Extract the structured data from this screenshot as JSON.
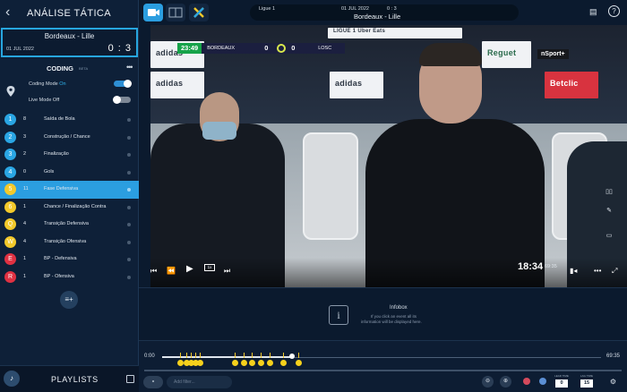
{
  "sidebar": {
    "title": "ANÁLISE TÁTICA",
    "back_icon": "chevron-left-icon",
    "match": {
      "teams": "Bordeaux - Lille",
      "date": "01 JUL 2022",
      "score": "0 : 3"
    },
    "coding": {
      "title": "CODING",
      "beta": "BETA",
      "menu_icon": "more-icon"
    },
    "toggles": [
      {
        "label": "Coding Mode",
        "value": "On",
        "state": "on"
      },
      {
        "label": "Live Mode",
        "value": "Off",
        "state": "off"
      }
    ],
    "codes": [
      {
        "key": "1",
        "count": "8",
        "label": "Saída de Bola",
        "color": "#2aa6e4",
        "active": false
      },
      {
        "key": "2",
        "count": "3",
        "label": "Construção / Chance",
        "color": "#2aa6e4",
        "active": false
      },
      {
        "key": "3",
        "count": "2",
        "label": "Finalização",
        "color": "#2aa6e4",
        "active": false
      },
      {
        "key": "4",
        "count": "0",
        "label": "Gols",
        "color": "#2aa6e4",
        "active": false
      },
      {
        "key": "5",
        "count": "11",
        "label": "Fase Defensiva",
        "color": "#f3c92a",
        "active": true
      },
      {
        "key": "6",
        "count": "1",
        "label": "Chance / Finalização Contra",
        "color": "#f3c92a",
        "active": false
      },
      {
        "key": "Q",
        "count": "4",
        "label": "Transição Defensiva",
        "color": "#f3c92a",
        "active": false
      },
      {
        "key": "W",
        "count": "4",
        "label": "Transição Ofensiva",
        "color": "#f3c92a",
        "active": false
      },
      {
        "key": "E",
        "count": "1",
        "label": "BP - Defensiva",
        "color": "#e03142",
        "active": false
      },
      {
        "key": "R",
        "count": "1",
        "label": "BP - Ofensiva",
        "color": "#e03142",
        "active": false
      }
    ],
    "add_label": "≡+",
    "playlists_label": "PLAYLISTS"
  },
  "topbar": {
    "league": "Ligue 1",
    "date": "01 JUL 2022",
    "score": "0 : 3",
    "teams": "Bordeaux - Lille"
  },
  "video": {
    "scorebug": {
      "time": "23:49",
      "home": "BORDEAUX",
      "home_score": "0",
      "away_score": "0",
      "away": "LOSC"
    },
    "boards": [
      "adidas",
      "adidas",
      "LIGUE 1 Uber Eats",
      "adidas",
      "Betclic",
      "Reguet"
    ],
    "broadcaster": "nSport+",
    "current_time": "18:34",
    "duration": "69:35",
    "speed": "1x"
  },
  "infobox": {
    "title": "Infobox",
    "line1": "If you click an event all its",
    "line2": "information will be displayed here."
  },
  "timeline": {
    "start": "0:00",
    "end": "69:35",
    "progress": 0.295,
    "events": [
      0.04,
      0.055,
      0.065,
      0.075,
      0.085,
      0.165,
      0.185,
      0.205,
      0.225,
      0.245,
      0.275,
      0.31
    ],
    "filter_placeholder": "Add filter...",
    "lead_time_label": "LEAD TIME",
    "lead_time": "0",
    "lag_time_label": "LAG TIME",
    "lag_time": "15"
  }
}
